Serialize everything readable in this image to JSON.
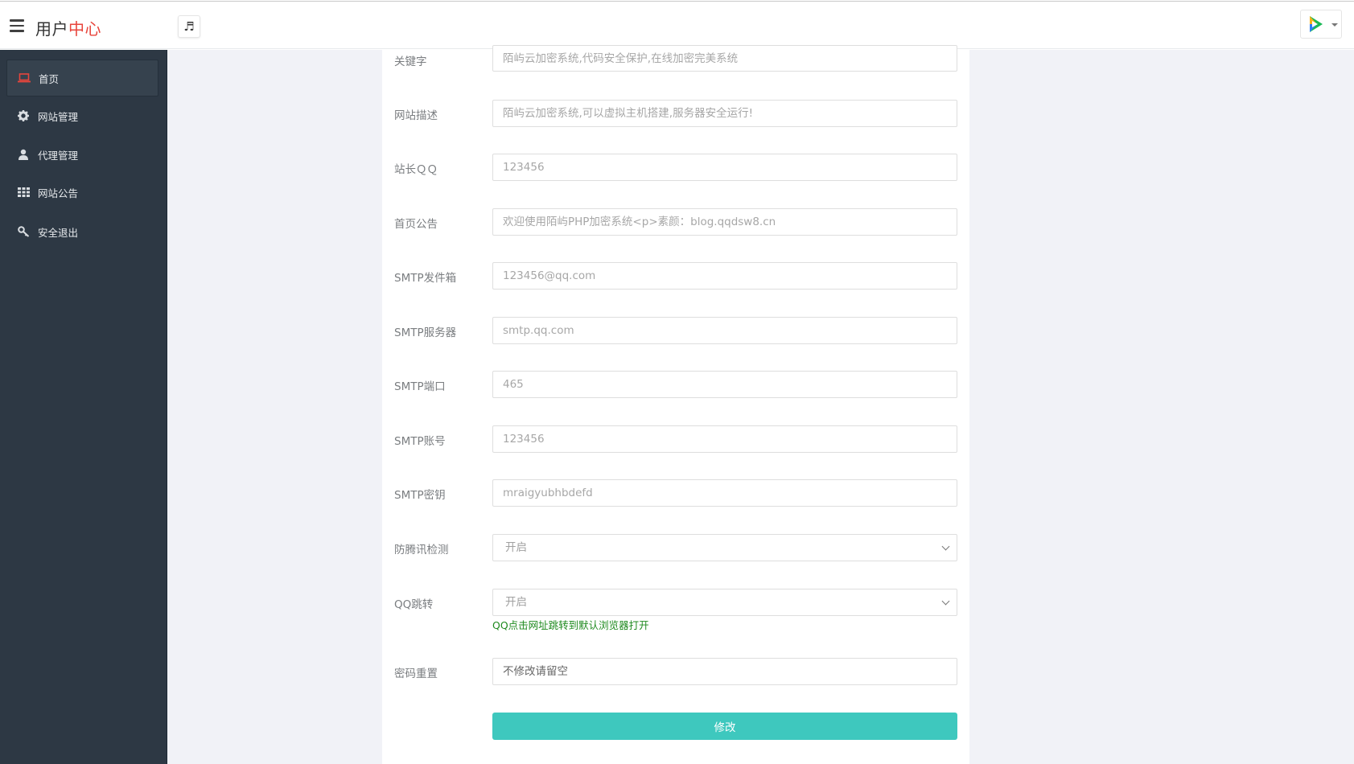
{
  "header": {
    "brand_prefix": "用户",
    "brand_accent": "中心",
    "music_icon": "♬"
  },
  "sidebar": {
    "items": [
      {
        "label": "首页",
        "icon": "laptop-icon",
        "active": true
      },
      {
        "label": "网站管理",
        "icon": "gear-icon",
        "active": false
      },
      {
        "label": "代理管理",
        "icon": "user-icon",
        "active": false
      },
      {
        "label": "网站公告",
        "icon": "grid-icon",
        "active": false
      },
      {
        "label": "安全退出",
        "icon": "key-icon",
        "active": false
      }
    ]
  },
  "form": {
    "keywords": {
      "label": "关键字",
      "placeholder": "陌屿云加密系统,代码安全保护,在线加密完美系统"
    },
    "description": {
      "label": "网站描述",
      "placeholder": "陌屿云加密系统,可以虚拟主机搭建,服务器安全运行!"
    },
    "qq": {
      "label": "站长ＱＱ",
      "placeholder": "123456"
    },
    "notice": {
      "label": "首页公告",
      "placeholder": "欢迎使用陌屿PHP加密系统<p>素颜：blog.qqdsw8.cn"
    },
    "smtp_sender": {
      "label": "SMTP发件箱",
      "placeholder": "123456@qq.com"
    },
    "smtp_server": {
      "label": "SMTP服务器",
      "placeholder": "smtp.qq.com"
    },
    "smtp_port": {
      "label": "SMTP端口",
      "placeholder": "465"
    },
    "smtp_account": {
      "label": "SMTP账号",
      "placeholder": "123456"
    },
    "smtp_key": {
      "label": "SMTP密钥",
      "placeholder": "mraigyubhbdefd"
    },
    "anti_tencent": {
      "label": "防腾讯检测",
      "value": "开启"
    },
    "qq_jump": {
      "label": "QQ跳转",
      "value": "开启",
      "hint": "QQ点击网址跳转到默认浏览器打开"
    },
    "password_reset": {
      "label": "密码重置",
      "placeholder": "不修改请留空"
    },
    "submit_label": "修改"
  },
  "colors": {
    "sidebar_bg": "#2d3844",
    "accent_red": "#e8453c",
    "button_teal": "#3ec8be",
    "hint_green": "#1f8a1f"
  }
}
